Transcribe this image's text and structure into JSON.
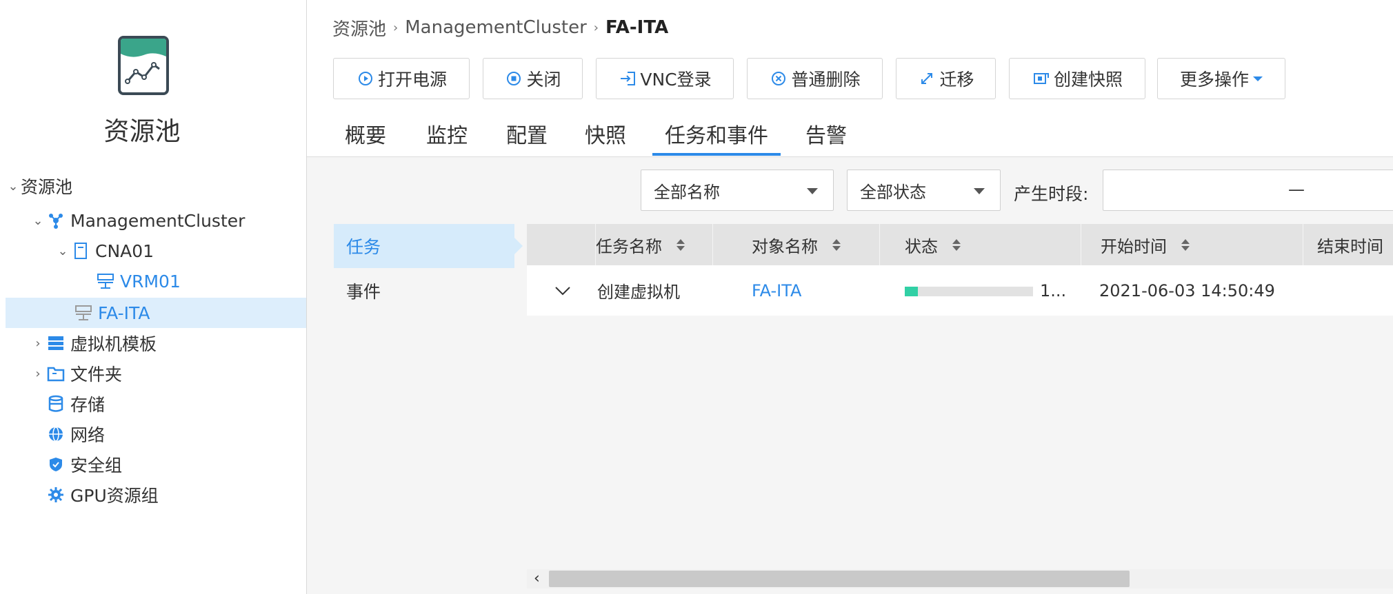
{
  "sidebar": {
    "title": "资源池",
    "tree": [
      {
        "label": "资源池",
        "icon": "caret-only"
      },
      {
        "label": "ManagementCluster",
        "icon": "cluster-icon"
      },
      {
        "label": "CNA01",
        "icon": "host-icon"
      },
      {
        "label": "VRM01",
        "icon": "vm-icon"
      },
      {
        "label": "FA-ITA",
        "icon": "vm-icon"
      },
      {
        "label": "虚拟机模板",
        "icon": "template-icon"
      },
      {
        "label": "文件夹",
        "icon": "folder-icon"
      },
      {
        "label": "存储",
        "icon": "storage-icon"
      },
      {
        "label": "网络",
        "icon": "network-icon"
      },
      {
        "label": "安全组",
        "icon": "security-group-icon"
      },
      {
        "label": "GPU资源组",
        "icon": "gpu-icon"
      }
    ]
  },
  "breadcrumb": {
    "items": [
      "资源池",
      "ManagementCluster"
    ],
    "current": "FA-ITA"
  },
  "toolbar": {
    "power_on": "打开电源",
    "shutdown": "关闭",
    "vnc_login": "VNC登录",
    "delete": "普通删除",
    "migrate": "迁移",
    "snapshot": "创建快照",
    "more": "更多操作"
  },
  "tabs": [
    "概要",
    "监控",
    "配置",
    "快照",
    "任务和事件",
    "告警"
  ],
  "filters": {
    "name_select": "全部名称",
    "status_select": "全部状态",
    "time_label": "产生时段:",
    "time_separator": "—"
  },
  "subnav": [
    "任务",
    "事件"
  ],
  "table": {
    "columns": [
      "任务名称",
      "对象名称",
      "状态",
      "开始时间",
      "结束时间"
    ],
    "rows": [
      {
        "task_name": "创建虚拟机",
        "object_name": "FA-ITA",
        "progress": 0.1,
        "status_text": "1...",
        "start_time": "2021-06-03 14:50:49"
      }
    ]
  },
  "colors": {
    "accent": "#2c8ae8",
    "progress": "#31d0a5",
    "selected_bg": "#ddeefc"
  }
}
